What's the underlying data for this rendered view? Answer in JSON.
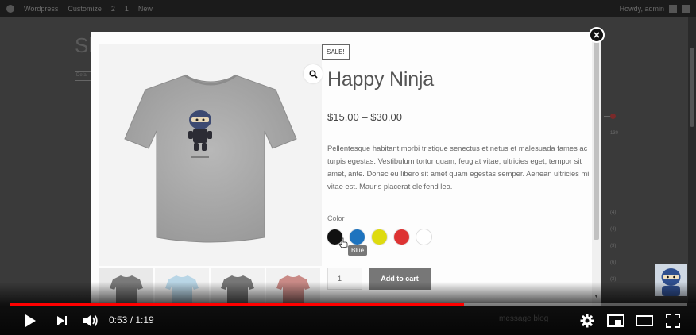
{
  "wp_adminbar": {
    "site": "Wordpress",
    "customize": "Customize",
    "updates": "2",
    "comments": "1",
    "new": "New",
    "howdy": "Howdy, admin"
  },
  "background": {
    "title": "Sl",
    "select": "Defa",
    "numbers": [
      "130",
      "(4)",
      "(4)",
      "(3)",
      "(6)",
      "(3)"
    ],
    "footer_text": "message blog"
  },
  "product": {
    "sale_badge": "SALE!",
    "title": "Happy Ninja",
    "price": "$15.00 – $30.00",
    "description": "Pellentesque habitant morbi tristique senectus et netus et malesuada fames ac turpis egestas. Vestibulum tortor quam, feugiat vitae, ultricies eget, tempor sit amet, ante. Donec eu libero sit amet quam egestas semper. Aenean ultricies mi vitae est. Mauris placerat eleifend leo.",
    "color_label": "Color",
    "swatches": [
      {
        "name": "Black",
        "color": "#111111"
      },
      {
        "name": "Blue",
        "color": "#1e73be"
      },
      {
        "name": "Yellow",
        "color": "#dedb10"
      },
      {
        "name": "Red",
        "color": "#dd3333"
      },
      {
        "name": "White",
        "color": "#ffffff"
      }
    ],
    "tooltip": "Blue",
    "quantity": "1",
    "add_to_cart": "Add to cart",
    "thumbnail_colors": [
      "#7a7a7a",
      "#b9d6e6",
      "#777777",
      "#c98a86"
    ]
  },
  "player": {
    "current_time": "0:53",
    "duration": "1:19",
    "time_display": "0:53 / 1:19",
    "progress_fraction": 0.67,
    "progress_color": "#ff0000",
    "icons": [
      "play-icon",
      "next-icon",
      "volume-icon",
      "settings-icon",
      "miniplayer-icon",
      "theater-icon",
      "fullscreen-icon"
    ]
  }
}
